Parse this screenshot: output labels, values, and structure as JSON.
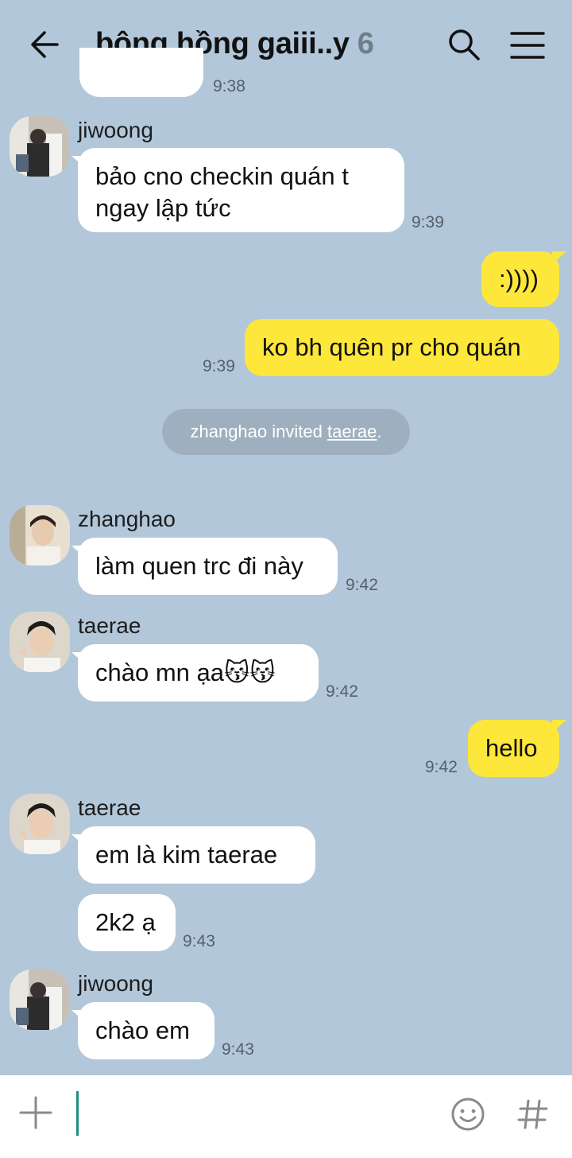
{
  "header": {
    "title": "bông hồng gaiii..y",
    "member_count": "6"
  },
  "messages": {
    "top_time": "9:38",
    "m1": {
      "sender": "jiwoong",
      "line1": "bảo cno checkin quán t",
      "line2": "ngay lập tức",
      "time": "9:39"
    },
    "m2": {
      "text": ":))))"
    },
    "m3": {
      "text": "ko bh quên pr cho quán",
      "time": "9:39"
    },
    "system": {
      "actor": "zhanghao",
      "verb": "invited",
      "target": "taerae"
    },
    "m4": {
      "sender": "zhanghao",
      "text": "làm quen trc đi này",
      "time": "9:42"
    },
    "m5": {
      "sender": "taerae",
      "text": "chào mn ạa😽😽",
      "time": "9:42"
    },
    "m6": {
      "text": "hello",
      "time": "9:42"
    },
    "m7": {
      "sender": "taerae",
      "text": "em là kim taerae"
    },
    "m8": {
      "text": "2k2 ạ",
      "time": "9:43"
    },
    "m9": {
      "sender": "jiwoong",
      "text": "chào em",
      "time": "9:43"
    }
  },
  "input": {
    "placeholder": ""
  },
  "icons": [
    "back-arrow-icon",
    "search-icon",
    "menu-icon",
    "plus-icon",
    "emoji-icon",
    "hash-icon"
  ],
  "colors": {
    "background": "#b2c7d9",
    "my_bubble": "#fde73b",
    "other_bubble": "#ffffff",
    "system_pill": "#9eb0bf",
    "cursor": "#1a8f7f"
  }
}
